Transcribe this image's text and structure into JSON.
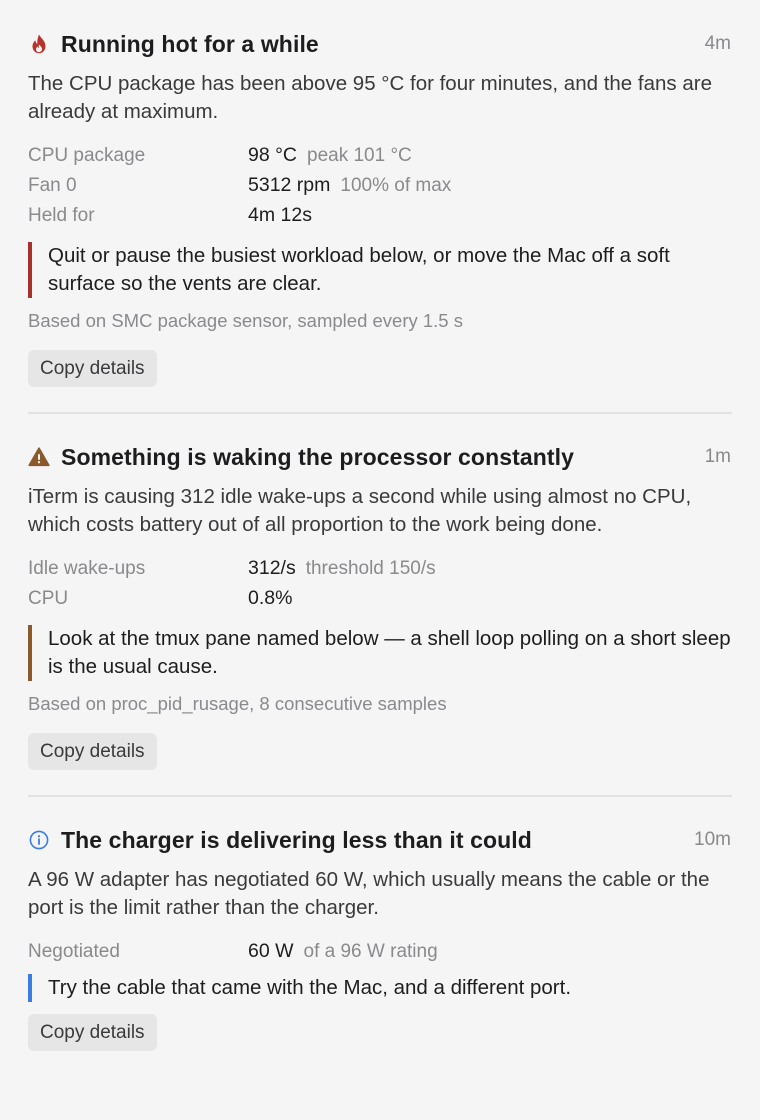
{
  "alerts": [
    {
      "icon": "fire-icon",
      "title": "Running hot for a while",
      "age": "4m",
      "description": "The CPU package has been above 95 °C for four minutes, and the fans are already at maximum.",
      "metrics": [
        {
          "label": "CPU package",
          "value": "98 °C",
          "note": "peak 101 °C"
        },
        {
          "label": "Fan 0",
          "value": "5312 rpm",
          "note": "100% of max"
        },
        {
          "label": "Held for",
          "value": "4m 12s",
          "note": ""
        }
      ],
      "advice": "Quit or pause the busiest workload below, or move the Mac off a soft surface so the vents are clear.",
      "source": "Based on SMC package sensor, sampled every 1.5 s",
      "button": "Copy details",
      "accent": "#a8302b"
    },
    {
      "icon": "warning-triangle-icon",
      "title": "Something is waking the processor constantly",
      "age": "1m",
      "description": "iTerm is causing 312 idle wake-ups a second while using almost no CPU, which costs battery out of all proportion to the work being done.",
      "metrics": [
        {
          "label": "Idle wake-ups",
          "value": "312/s",
          "note": "threshold 150/s"
        },
        {
          "label": "CPU",
          "value": "0.8%",
          "note": ""
        }
      ],
      "advice": "Look at the tmux pane named below — a shell loop polling on a short sleep is the usual cause.",
      "source": "Based on proc_pid_rusage, 8 consecutive samples",
      "button": "Copy details",
      "accent": "#8a5a2b"
    },
    {
      "icon": "info-circle-icon",
      "title": "The charger is delivering less than it could",
      "age": "10m",
      "description": "A 96 W adapter has negotiated 60 W, which usually means the cable or the port is the limit rather than the charger.",
      "metrics": [
        {
          "label": "Negotiated",
          "value": "60 W",
          "note": "of a 96 W rating"
        }
      ],
      "advice": "Try the cable that came with the Mac, and a different port.",
      "source": "",
      "button": "Copy details",
      "accent": "#3b7de0"
    }
  ]
}
